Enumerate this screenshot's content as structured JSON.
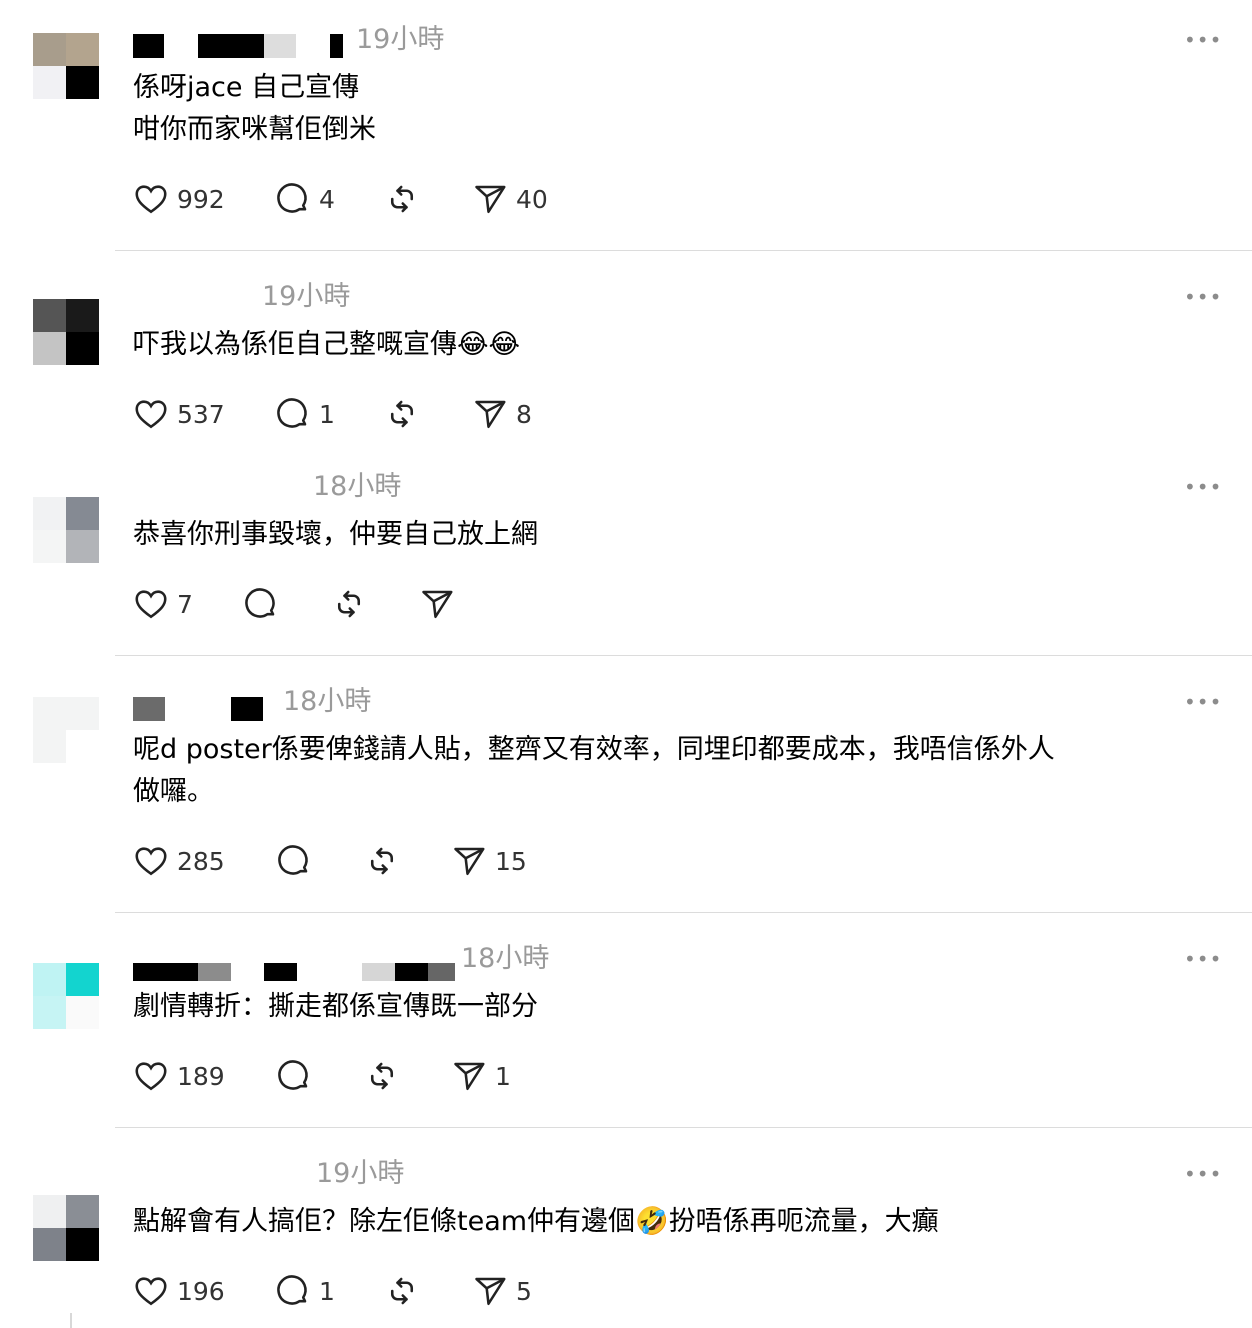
{
  "ui": {
    "more_label": "•••"
  },
  "comments": [
    {
      "time": "19小時",
      "lines": [
        "係呀jace 自己宣傳",
        "咁你而家咪幫佢倒米"
      ],
      "likes": "992",
      "replies": "4",
      "shares": "40"
    },
    {
      "time": "19小時",
      "lines": [
        "吓我以為係佢自己整嘅宣傳😂😂"
      ],
      "likes": "537",
      "replies": "1",
      "shares": "8"
    },
    {
      "time": "18小時",
      "lines": [
        "恭喜你刑事毀壞，仲要自己放上網"
      ],
      "likes": "7",
      "replies": "",
      "shares": ""
    },
    {
      "time": "18小時",
      "lines": [
        "呢d poster係要俾錢請人貼，整齊又有效率，同埋印都要成本，我唔信係外人",
        "做囉。"
      ],
      "likes": "285",
      "replies": "",
      "shares": "15"
    },
    {
      "time": "18小時",
      "lines": [
        "劇情轉折：撕走都係宣傳既一部分"
      ],
      "likes": "189",
      "replies": "",
      "shares": "1"
    },
    {
      "time": "19小時",
      "lines": [
        "點解會有人搞佢？除左佢條team仲有邊個🤣扮唔係再呃流量，大癲"
      ],
      "likes": "196",
      "replies": "1",
      "shares": "5"
    }
  ]
}
